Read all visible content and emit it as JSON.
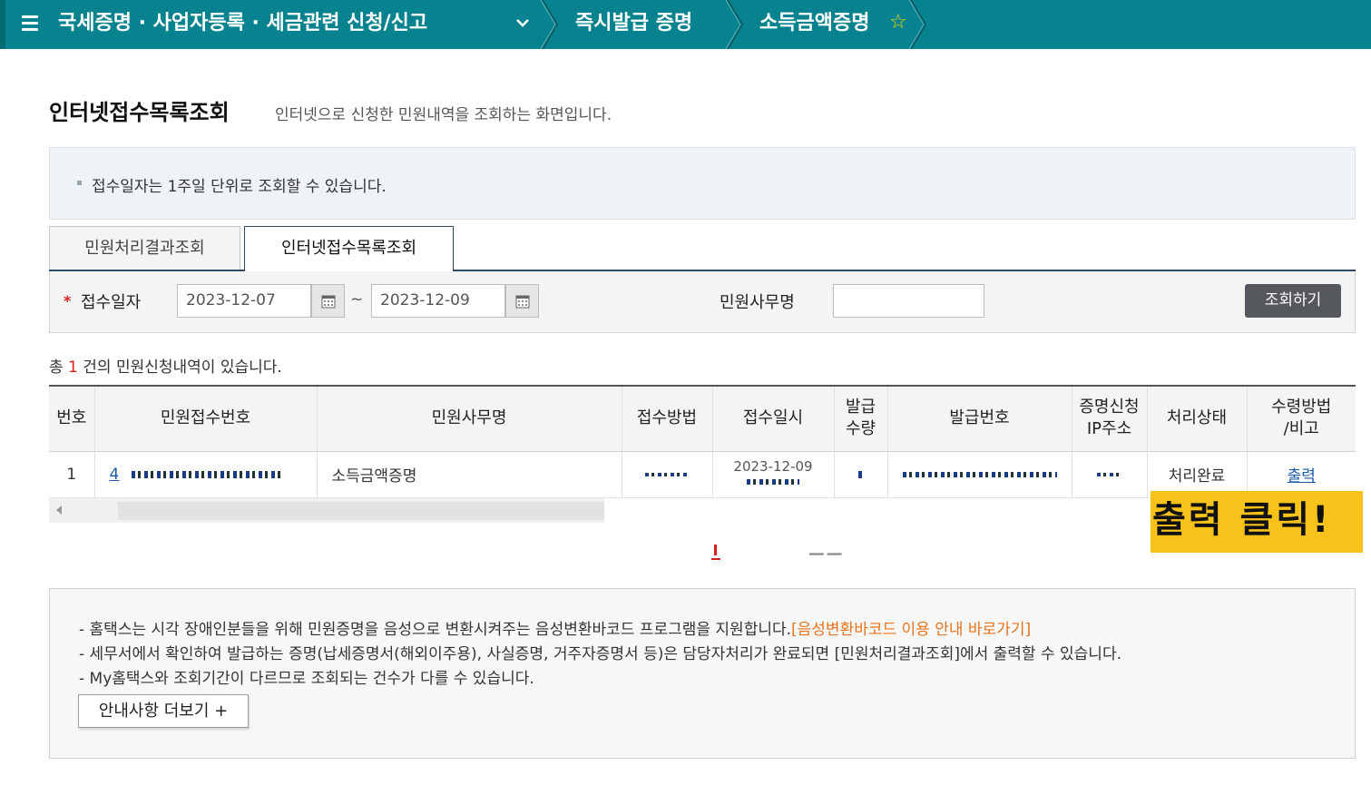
{
  "header": {
    "menu_icon": "hamburger-menu-icon",
    "breadcrumb": [
      "국세증명 · 사업자등록 · 세금관련 신청/신고",
      "즉시발급 증명",
      "소득금액증명"
    ],
    "star_icon": "star-outline-icon",
    "colors": {
      "bar": "#06838f",
      "star": "#f1d800"
    }
  },
  "page": {
    "title": "인터넷접수목록조회",
    "description": "인터넷으로 신청한 민원내역을 조회하는 화면입니다."
  },
  "notice": {
    "text": "접수일자는 1주일 단위로 조회할 수 있습니다."
  },
  "tabs": [
    {
      "label": "민원처리결과조회",
      "active": false
    },
    {
      "label": "인터넷접수목록조회",
      "active": true
    }
  ],
  "search": {
    "date_label": "접수일자",
    "date_from": "2023-12-07",
    "date_to": "2023-12-09",
    "tilde": "~",
    "name_label": "민원사무명",
    "name_value": "",
    "button": "조회하기"
  },
  "result": {
    "prefix": "총",
    "count": "1",
    "suffix": "건의 민원신청내역이 있습니다."
  },
  "table": {
    "headers": [
      "번호",
      "민원접수번호",
      "민원사무명",
      "접수방법",
      "접수일시",
      "발급\n수량",
      "발급번호",
      "증명신청\nIP주소",
      "처리상태",
      "수령방법\n/비고"
    ],
    "rows": [
      {
        "no": "1",
        "receipt_prefix": "4",
        "office_name": "소득금액증명",
        "date_visible": "2023-12-09",
        "status": "처리완료",
        "action": "출력"
      }
    ]
  },
  "callout": {
    "text": "출력 클릭!",
    "color": "#f7c31a"
  },
  "info": {
    "line1": "- 홈택스는 시각 장애인분들을 위해 민원증명을 음성으로 변환시켜주는 음성변환바코드 프로그램을 지원합니다.",
    "line1_link": "[음성변환바코드 이용 안내 바로가기]",
    "line2": "- 세무서에서 확인하여 발급하는 증명(납세증명서(해외이주용), 사실증명, 거주자증명서 등)은 담당자처리가 완료되면 [민원처리결과조회]에서 출력할 수 있습니다.",
    "line3": "- My홈택스와 조회기간이 다르므로 조회되는 건수가 다를 수 있습니다.",
    "more_button": "안내사항 더보기 +"
  }
}
